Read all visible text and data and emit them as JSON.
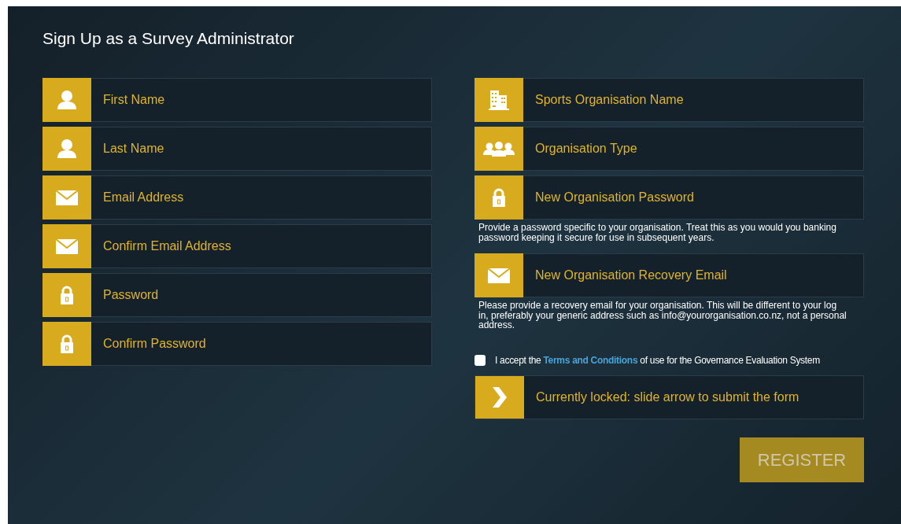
{
  "title": "Sign Up as a Survey Administrator",
  "left_fields": [
    {
      "kind": "person",
      "placeholder": "First Name"
    },
    {
      "kind": "person",
      "placeholder": "Last Name"
    },
    {
      "kind": "mail",
      "placeholder": "Email Address"
    },
    {
      "kind": "mail",
      "placeholder": "Confirm Email Address"
    },
    {
      "kind": "lock",
      "placeholder": "Password"
    },
    {
      "kind": "lock",
      "placeholder": "Confirm Password"
    }
  ],
  "right_fields": [
    {
      "kind": "building",
      "placeholder": "Sports Organisation Name"
    },
    {
      "kind": "group",
      "placeholder": "Organisation Type"
    },
    {
      "kind": "lock",
      "placeholder": "New Organisation Password",
      "help": "Provide a password specific to your organisation. Treat this as you would you banking password keeping it secure for use in subsequent years."
    },
    {
      "kind": "mail",
      "placeholder": "New Organisation Recovery Email",
      "help": "Please provide a recovery email for your organisation. This will be different to your log in, preferably your generic address such as info@yourorganisation.co.nz, not a personal address."
    }
  ],
  "terms": {
    "checked": false,
    "before": "I accept the",
    "link": "Terms and Conditions",
    "after": "of use for the Governance Evaluation System"
  },
  "slider": {
    "label": "Currently locked: slide arrow to submit the form"
  },
  "register": {
    "label": "REGISTER",
    "disabled": true
  }
}
